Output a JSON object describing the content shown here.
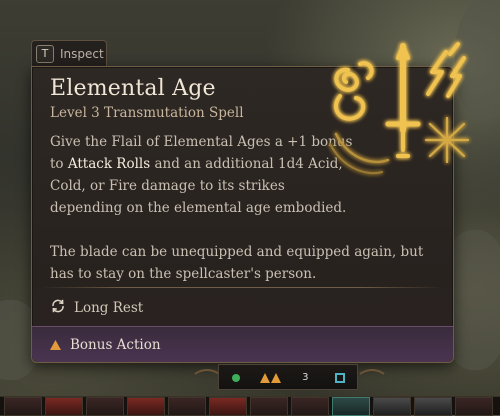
{
  "inspect": {
    "key": "T",
    "label": "Inspect"
  },
  "spell": {
    "title": "Elemental Age",
    "subtitle": "Level 3 Transmutation Spell",
    "desc_part1": "Give the  Flail of Elemental Ages a +1 bonus to ",
    "desc_highlight": "Attack Rolls",
    "desc_part2": " and an additional 1d4 Acid, Cold, or Fire damage to its strikes depending on the elemental age embodied.",
    "desc2": "The blade can be unequipped and equipped again, but has to stay on the spellcaster's person.",
    "rest": "Long Rest",
    "action": "Bonus Action"
  },
  "hotbar": {
    "resource_count": "3"
  },
  "icons": {
    "rest": "long-rest-icon",
    "action": "bonus-action-triangle-icon",
    "art": "elemental-sword-icon"
  },
  "colors": {
    "accent_gold": "#e9b845",
    "action_orange": "#e39a3a",
    "panel": "#2b2521",
    "action_bar": "#4a3451"
  }
}
